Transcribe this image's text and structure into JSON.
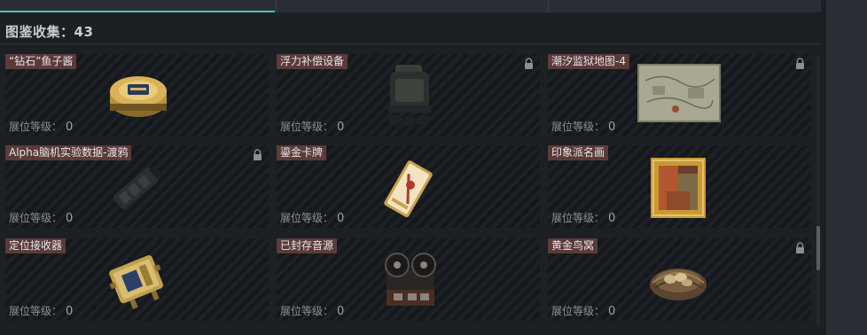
{
  "collection": {
    "label": "图鉴收集：43"
  },
  "level_label": "展位等级：",
  "cards": [
    {
      "name": "“钻石”鱼子酱",
      "level": "0",
      "locked": false,
      "icon": "caviar-tin-icon"
    },
    {
      "name": "浮力补偿设备",
      "level": "0",
      "locked": true,
      "icon": "buoyancy-device-icon"
    },
    {
      "name": "潮汐监狱地图-4",
      "level": "0",
      "locked": true,
      "icon": "prison-map-icon"
    },
    {
      "name": "Alpha脑机实验数据-渡鸦",
      "level": "0",
      "locked": true,
      "icon": "data-device-icon"
    },
    {
      "name": "鎏金卡牌",
      "level": "0",
      "locked": false,
      "icon": "gilded-card-icon"
    },
    {
      "name": "印象派名画",
      "level": "0",
      "locked": false,
      "icon": "framed-painting-icon"
    },
    {
      "name": "定位接收器",
      "level": "0",
      "locked": false,
      "icon": "locator-receiver-icon"
    },
    {
      "name": "已封存音源",
      "level": "0",
      "locked": false,
      "icon": "reel-tape-recorder-icon"
    },
    {
      "name": "黄金鸟窝",
      "level": "0",
      "locked": true,
      "icon": "golden-nest-icon"
    }
  ],
  "colors": {
    "accent": "#4fc3a1",
    "name_tag": "#5c3a3a",
    "card_bg": "#15181c"
  }
}
